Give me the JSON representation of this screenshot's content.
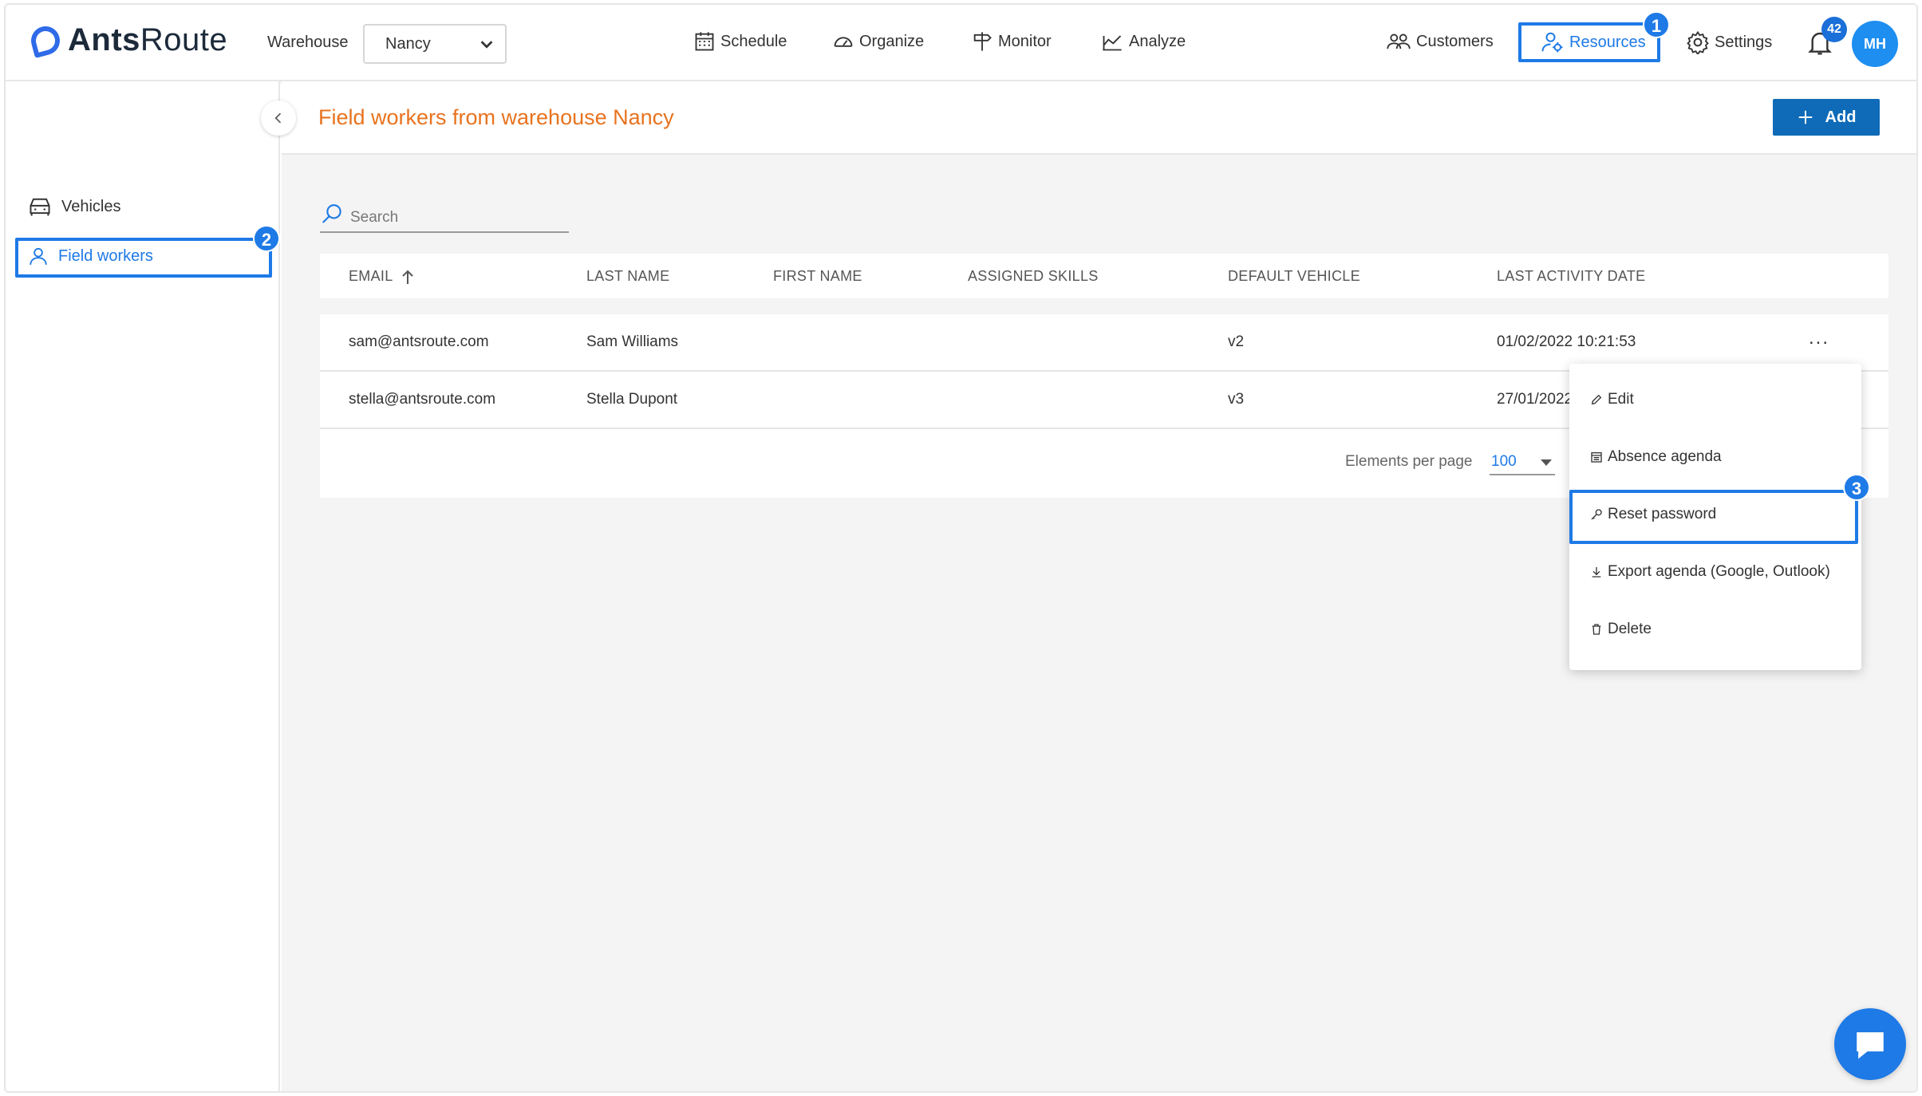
{
  "app": {
    "logo_bold": "Ants",
    "logo_light": "Route"
  },
  "header": {
    "warehouse_label": "Warehouse",
    "warehouse_value": "Nancy",
    "nav": {
      "schedule": "Schedule",
      "organize": "Organize",
      "monitor": "Monitor",
      "analyze": "Analyze",
      "customers": "Customers",
      "resources": "Resources",
      "settings": "Settings"
    },
    "notification_count": "42",
    "avatar_initials": "MH"
  },
  "steps": {
    "one": "1",
    "two": "2",
    "three": "3"
  },
  "sidebar": {
    "items": [
      {
        "label": "Vehicles",
        "icon": "vehicle-icon"
      },
      {
        "label": "Field workers",
        "icon": "user-icon"
      }
    ]
  },
  "main": {
    "title": "Field workers from warehouse Nancy",
    "add_label": "Add",
    "search_placeholder": "Search",
    "columns": {
      "email": "EMAIL",
      "last_name": "LAST NAME",
      "first_name": "FIRST NAME",
      "skills": "ASSIGNED SKILLS",
      "vehicle": "DEFAULT VEHICLE",
      "activity": "LAST ACTIVITY DATE"
    },
    "rows": [
      {
        "email": "sam@antsroute.com",
        "last_name": "Sam Williams",
        "first_name": "",
        "skills": "",
        "vehicle": "v2",
        "activity": "01/02/2022 10:21:53"
      },
      {
        "email": "stella@antsroute.com",
        "last_name": "Stella Dupont",
        "first_name": "",
        "skills": "",
        "vehicle": "v3",
        "activity": "27/01/2022"
      }
    ],
    "more_label": "...",
    "pager_label": "Elements per page",
    "pager_value": "100"
  },
  "menu": {
    "edit": "Edit",
    "absence": "Absence agenda",
    "reset": "Reset password",
    "export": "Export agenda (Google, Outlook)",
    "delete": "Delete"
  },
  "colors": {
    "accent": "#1e7ae6",
    "title": "#e8731f",
    "add_button": "#0f6bb8"
  }
}
